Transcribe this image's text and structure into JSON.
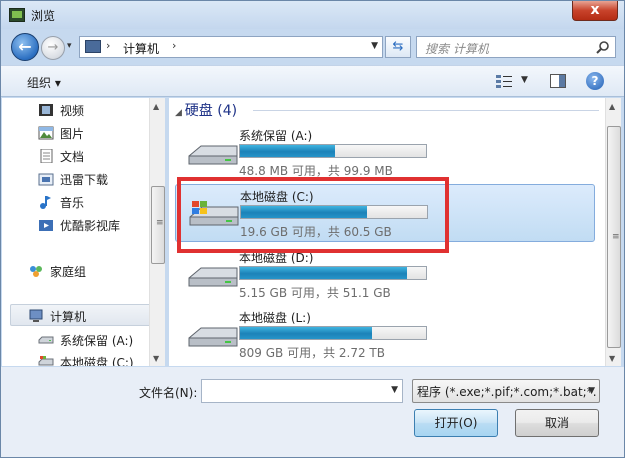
{
  "window": {
    "title": "浏览",
    "close_glyph": "x"
  },
  "navigation": {
    "address_path": [
      "计算机"
    ],
    "search_placeholder": "搜索 计算机"
  },
  "toolbar": {
    "organize_label": "组织 ▾"
  },
  "nav_pane": {
    "items": [
      {
        "label": "视频",
        "icon": "video-library-icon"
      },
      {
        "label": "图片",
        "icon": "pictures-library-icon"
      },
      {
        "label": "文档",
        "icon": "documents-library-icon"
      },
      {
        "label": "迅雷下载",
        "icon": "download-folder-icon"
      },
      {
        "label": "音乐",
        "icon": "music-library-icon"
      },
      {
        "label": "优酷影视库",
        "icon": "media-library-icon"
      },
      {
        "label": "家庭组",
        "icon": "homegroup-icon"
      },
      {
        "label": "计算机",
        "icon": "computer-icon",
        "selected": true
      },
      {
        "label": "系统保留 (A:)",
        "icon": "drive-icon"
      },
      {
        "label": "本地磁盘 (C:)",
        "icon": "drive-icon"
      }
    ]
  },
  "content": {
    "group_header": "硬盘 (4)",
    "drives": [
      {
        "name": "系统保留 (A:)",
        "info": "48.8 MB 可用，共 99.9 MB",
        "used_fraction": 0.51,
        "selected": false
      },
      {
        "name": "本地磁盘 (C:)",
        "info": "19.6 GB 可用，共 60.5 GB",
        "used_fraction": 0.68,
        "selected": true
      },
      {
        "name": "本地磁盘 (D:)",
        "info": "5.15 GB 可用，共 51.1 GB",
        "used_fraction": 0.9,
        "selected": false
      },
      {
        "name": "本地磁盘 (L:)",
        "info": "809 GB 可用，共 2.72 TB",
        "used_fraction": 0.71,
        "selected": false
      }
    ]
  },
  "bottom": {
    "filename_label": "文件名(N):",
    "filename_value": "",
    "filter_label": "程序 (*.exe;*.pif;*.com;*.bat;*.",
    "open_label": "打开(O)",
    "cancel_label": "取消"
  },
  "colors": {
    "highlight": "#e03131",
    "progress": "#1c82b8"
  }
}
